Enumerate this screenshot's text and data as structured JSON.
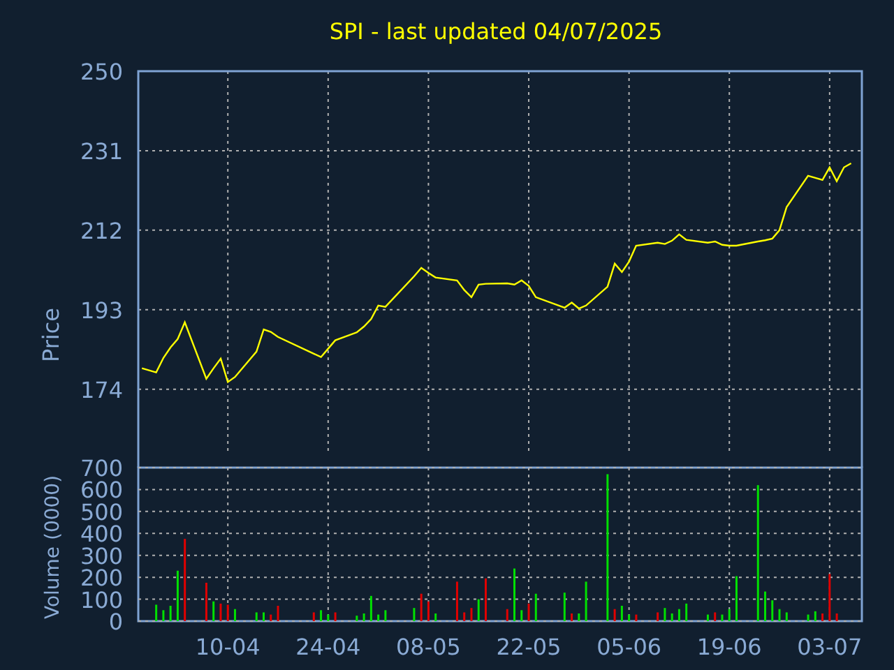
{
  "title": "SPI - last updated 04/07/2025",
  "price_chart": {
    "chart_data": {
      "type": "line",
      "grid": true,
      "ylabel": "Price",
      "ylim": [
        158.6,
        250
      ],
      "yticks": [
        174,
        193,
        212,
        231,
        250
      ],
      "categories": [
        null,
        null,
        null,
        null,
        null,
        null,
        null,
        null,
        null,
        null,
        null,
        null,
        null,
        null,
        null,
        null,
        null,
        null,
        null,
        null,
        null,
        null,
        null,
        null,
        null,
        null,
        null,
        null,
        null,
        null,
        null,
        null,
        null,
        null,
        null,
        null,
        null,
        null,
        null,
        null,
        null,
        null,
        null,
        null,
        null,
        null,
        null,
        null,
        null,
        null,
        null,
        null,
        null,
        null,
        null,
        null,
        null,
        null,
        null,
        null,
        null,
        null,
        null,
        null,
        null,
        null,
        null,
        null,
        null,
        null,
        null,
        null,
        null,
        null,
        null,
        null,
        null,
        null,
        null,
        null,
        null,
        null,
        null,
        null,
        null,
        null,
        null,
        null,
        null,
        null,
        null,
        null,
        null,
        null,
        null,
        null,
        null,
        null,
        null,
        null,
        null
      ],
      "series": [
        {
          "color": "#ffff00",
          "values": [
            179.0,
            null,
            178.0,
            181.5,
            184.0,
            186.0,
            190.0,
            null,
            null,
            176.5,
            179.0,
            181.3,
            175.7,
            176.9,
            null,
            null,
            183.0,
            188.3,
            187.7,
            186.5,
            null,
            null,
            null,
            null,
            182.5,
            181.7,
            183.7,
            185.7,
            null,
            null,
            187.6,
            189.0,
            190.8,
            194.0,
            193.7,
            null,
            null,
            null,
            201.0,
            203.0,
            201.8,
            200.7,
            null,
            null,
            200.0,
            197.7,
            196.0,
            199.0,
            199.2,
            null,
            null,
            199.3,
            199.0,
            200.0,
            198.7,
            196.0,
            null,
            null,
            null,
            193.5,
            194.7,
            193.3,
            194.0,
            null,
            null,
            198.5,
            204.0,
            202.0,
            204.5,
            208.3,
            null,
            null,
            209.0,
            208.7,
            209.5,
            211.0,
            209.7,
            null,
            null,
            209.0,
            209.3,
            208.5,
            208.3,
            208.3,
            null,
            null,
            209.3,
            209.6,
            210.0,
            212.0,
            217.5,
            null,
            null,
            225.0,
            224.5,
            224.0,
            227.0,
            223.7,
            227.0,
            228.0,
            null
          ]
        }
      ]
    }
  },
  "volume_chart": {
    "chart_data": {
      "type": "bar",
      "grid": true,
      "ylabel": "Volume (0000)",
      "stacked": true,
      "ylim": [
        0,
        700
      ],
      "yticks": [
        0,
        100,
        200,
        300,
        400,
        500,
        600,
        700
      ],
      "categories": [
        null,
        null,
        null,
        null,
        null,
        null,
        null,
        null,
        null,
        null,
        null,
        null,
        "10-04",
        null,
        null,
        null,
        null,
        null,
        null,
        null,
        null,
        null,
        null,
        null,
        null,
        null,
        "24-04",
        null,
        null,
        null,
        null,
        null,
        null,
        null,
        null,
        null,
        null,
        null,
        null,
        null,
        "08-05",
        null,
        null,
        null,
        null,
        null,
        null,
        null,
        null,
        null,
        null,
        null,
        null,
        null,
        "22-05",
        null,
        null,
        null,
        null,
        null,
        null,
        null,
        null,
        null,
        null,
        null,
        null,
        null,
        "05-06",
        null,
        null,
        null,
        null,
        null,
        null,
        null,
        null,
        null,
        null,
        null,
        null,
        null,
        "19-06",
        null,
        null,
        null,
        null,
        null,
        null,
        null,
        null,
        null,
        null,
        null,
        null,
        null,
        "03-07",
        null,
        null,
        null,
        null
      ],
      "series": [
        {
          "color": "#00e000",
          "values": [
            null,
            null,
            75,
            50,
            70,
            230,
            null,
            null,
            null,
            null,
            90,
            null,
            null,
            55,
            null,
            null,
            40,
            40,
            null,
            null,
            null,
            null,
            null,
            null,
            null,
            50,
            30,
            null,
            null,
            null,
            25,
            35,
            115,
            30,
            50,
            null,
            null,
            null,
            60,
            null,
            null,
            35,
            null,
            null,
            null,
            null,
            null,
            100,
            null,
            null,
            null,
            null,
            240,
            50,
            null,
            125,
            null,
            null,
            null,
            130,
            null,
            35,
            180,
            null,
            null,
            670,
            null,
            70,
            30,
            null,
            null,
            null,
            null,
            60,
            35,
            55,
            80,
            null,
            null,
            30,
            null,
            30,
            55,
            205,
            null,
            null,
            620,
            135,
            95,
            55,
            40,
            null,
            null,
            30,
            45,
            null,
            null,
            null,
            null,
            null,
            null
          ]
        },
        {
          "color": "#e00000",
          "values": [
            null,
            null,
            null,
            null,
            null,
            null,
            375,
            null,
            null,
            175,
            null,
            80,
            75,
            null,
            null,
            null,
            null,
            null,
            30,
            70,
            null,
            null,
            null,
            null,
            40,
            null,
            null,
            40,
            null,
            null,
            null,
            null,
            null,
            null,
            null,
            null,
            null,
            null,
            null,
            125,
            90,
            null,
            null,
            null,
            180,
            40,
            60,
            null,
            195,
            null,
            null,
            55,
            null,
            null,
            80,
            null,
            null,
            null,
            null,
            null,
            35,
            null,
            null,
            null,
            null,
            null,
            55,
            null,
            null,
            30,
            null,
            null,
            40,
            null,
            null,
            null,
            null,
            null,
            null,
            null,
            40,
            null,
            null,
            null,
            null,
            null,
            null,
            null,
            null,
            null,
            null,
            null,
            null,
            null,
            null,
            35,
            215,
            35,
            null,
            null,
            null
          ]
        }
      ]
    }
  }
}
